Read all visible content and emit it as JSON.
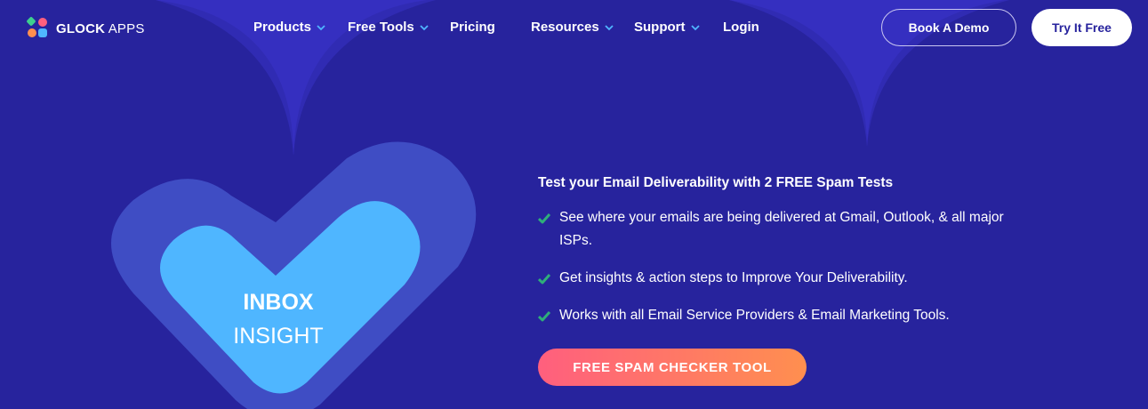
{
  "brand": {
    "name_bold": "GLOCK",
    "name_light": " APPS",
    "logo_colors": [
      "#3ecf8e",
      "#ff5f7e",
      "#ff8f4f",
      "#4fb6ff"
    ]
  },
  "nav": {
    "items": [
      {
        "label": "Products",
        "dropdown": true
      },
      {
        "label": "Free Tools",
        "dropdown": true
      },
      {
        "label": "Pricing",
        "dropdown": false
      },
      {
        "label": "Resources",
        "dropdown": true
      },
      {
        "label": "Support",
        "dropdown": true
      },
      {
        "label": "Login",
        "dropdown": false
      }
    ],
    "book_demo_label": "Book A Demo",
    "try_free_label": "Try It Free"
  },
  "hero": {
    "heart_line1": "INBOX",
    "heart_line2": "INSIGHT",
    "headline": "Test your Email Deliverability with 2 FREE Spam Tests",
    "features": [
      "See where your emails are being delivered at Gmail, Outlook, & all major ISPs.",
      "Get insights & action steps to Improve Your Deliverability.",
      "Works with all Email Service Providers & Email Marketing Tools."
    ],
    "cta_label": "FREE SPAM CHECKER TOOL"
  },
  "colors": {
    "background": "#27239d",
    "accent_blue": "#4fb6ff",
    "check_green": "#2fae7a",
    "cta_gradient": [
      "#ff5f7e",
      "#ff8f4f"
    ]
  }
}
